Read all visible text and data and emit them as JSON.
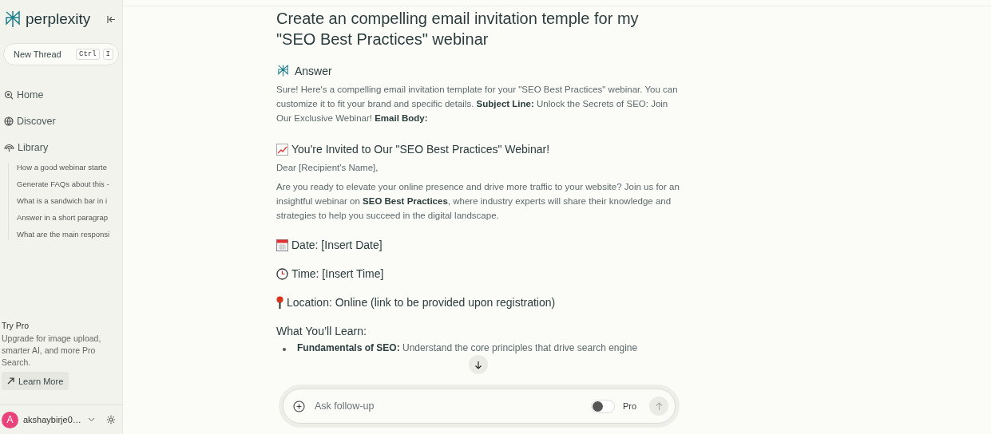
{
  "sidebar": {
    "brand": "perplexity",
    "new_thread": {
      "label": "New Thread",
      "keys": [
        "Ctrl",
        "I"
      ]
    },
    "nav": [
      {
        "kind": "home",
        "label": "Home",
        "selected": false
      },
      {
        "kind": "discover",
        "label": "Discover",
        "selected": false
      },
      {
        "kind": "library",
        "label": "Library",
        "selected": false
      }
    ],
    "library_items": [
      "How a good webinar starte",
      "Generate FAQs about this -",
      "What is a sandwich bar in i",
      "Answer in a short paragrap",
      "What are the main responsi"
    ],
    "promo": {
      "title": "Try Pro",
      "text": "Upgrade for image upload, smarter AI, and more Pro Search.",
      "button": "Learn More"
    },
    "user": {
      "initial": "A",
      "name": "akshaybirje0…"
    }
  },
  "thread": {
    "question": "Create an compelling email invitation temple for my \"SEO Best Practices\" webinar",
    "answer_label": "Answer",
    "blocks": [
      {
        "kind": "p",
        "text": "Sure! Here's a compelling email invitation template for your \"SEO Best Practices\" webinar. You can customize it to fit your brand and specific details. **Subject Line:** Unlock the Secrets of SEO: Join Our Exclusive Webinar! **Email Body:**"
      },
      {
        "kind": "trend",
        "text": "You're Invited to Our \"SEO Best Practices\" Webinar!"
      },
      {
        "kind": "p",
        "text": "Dear [Recipient's Name],"
      },
      {
        "kind": "p",
        "text": "Are you ready to elevate your online presence and drive more traffic to your website? Join us for an insightful webinar on **SEO Best Practices**, where industry experts will share their knowledge and strategies to help you succeed in the digital landscape."
      },
      {
        "kind": "date",
        "text": "Date: [Insert Date]"
      },
      {
        "kind": "time",
        "text": "Time: [Insert Time]"
      },
      {
        "kind": "place",
        "text": "Location: Online (link to be provided upon registration)"
      },
      {
        "kind": "h4",
        "text": "What You’ll Learn:"
      },
      {
        "kind": "li",
        "text": "**Fundamentals of SEO:** Understand the core principles that drive search engine"
      }
    ]
  },
  "composer": {
    "placeholder": "Ask follow-up",
    "pro": {
      "label": "Pro",
      "on": false
    }
  }
}
